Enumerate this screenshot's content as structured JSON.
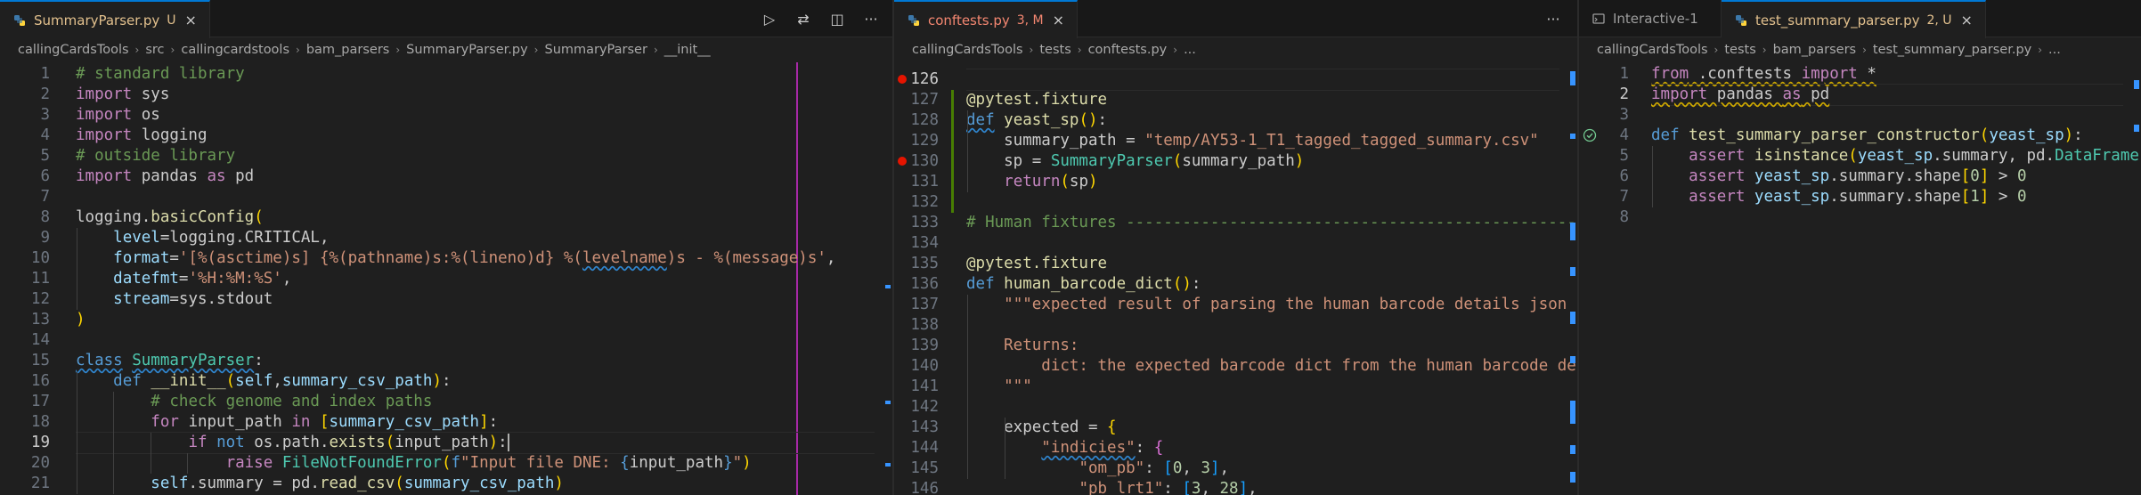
{
  "colors": {
    "keyword": "#569cd6",
    "control": "#c586c0",
    "function": "#dcdcaa",
    "class": "#4ec9b0",
    "string": "#ce9178",
    "number": "#b5cea8",
    "comment": "#6a9955",
    "variable": "#9cdcfe",
    "accent": "#0078d4",
    "ruler": "#a629a6",
    "error": "#f48771",
    "modified": "#e2c08d",
    "breakpoint": "#e51400"
  },
  "pane1": {
    "tab": {
      "name": "SummaryParser.py",
      "status": "U",
      "close": "×",
      "icon": "python-file-icon"
    },
    "actions": [
      {
        "name": "run-python-icon",
        "glyph": "▷"
      },
      {
        "name": "compare-changes-icon",
        "glyph": "⇄"
      },
      {
        "name": "split-editor-icon",
        "glyph": "◫"
      },
      {
        "name": "more-actions-icon",
        "glyph": "···"
      }
    ],
    "breadcrumb": [
      "callingCardsTools",
      "src",
      "callingcardstools",
      "bam_parsers",
      "SummaryParser.py",
      "SummaryParser",
      "__init__"
    ],
    "lines": [
      {
        "n": "1",
        "tokens": [
          {
            "c": "cm",
            "t": "# standard library"
          }
        ]
      },
      {
        "n": "2",
        "tokens": [
          {
            "c": "kw2",
            "t": "import"
          },
          {
            "c": "plain",
            "t": " sys"
          }
        ]
      },
      {
        "n": "3",
        "tokens": [
          {
            "c": "kw2",
            "t": "import"
          },
          {
            "c": "plain",
            "t": " os"
          }
        ]
      },
      {
        "n": "4",
        "tokens": [
          {
            "c": "kw2",
            "t": "import"
          },
          {
            "c": "plain",
            "t": " logging"
          }
        ]
      },
      {
        "n": "5",
        "tokens": [
          {
            "c": "cm",
            "t": "# outside library"
          }
        ]
      },
      {
        "n": "6",
        "tokens": [
          {
            "c": "kw2",
            "t": "import"
          },
          {
            "c": "plain",
            "t": " pandas "
          },
          {
            "c": "kw2",
            "t": "as"
          },
          {
            "c": "plain",
            "t": " pd"
          }
        ]
      },
      {
        "n": "7",
        "tokens": []
      },
      {
        "n": "8",
        "tokens": [
          {
            "c": "plain",
            "t": "logging."
          },
          {
            "c": "fn",
            "t": "basicConfig"
          },
          {
            "c": "par",
            "t": "("
          }
        ]
      },
      {
        "n": "9",
        "tokens": [
          {
            "c": "plain",
            "t": "    "
          },
          {
            "c": "var",
            "t": "level"
          },
          {
            "c": "plain",
            "t": "=logging.CRITICAL,"
          }
        ]
      },
      {
        "n": "10",
        "tokens": [
          {
            "c": "plain",
            "t": "    "
          },
          {
            "c": "var",
            "t": "format"
          },
          {
            "c": "plain",
            "t": "="
          },
          {
            "c": "str",
            "t": "'[%(asctime)s] {%(pathname)s:%(lineno)d} %("
          },
          {
            "c": "str sq",
            "t": "levelname"
          },
          {
            "c": "str",
            "t": ")s - %(message)s'"
          },
          {
            "c": "plain",
            "t": ","
          }
        ]
      },
      {
        "n": "11",
        "tokens": [
          {
            "c": "plain",
            "t": "    "
          },
          {
            "c": "var",
            "t": "datefmt"
          },
          {
            "c": "plain",
            "t": "="
          },
          {
            "c": "str",
            "t": "'%H:%M:%S'"
          },
          {
            "c": "plain",
            "t": ","
          }
        ]
      },
      {
        "n": "12",
        "tokens": [
          {
            "c": "plain",
            "t": "    "
          },
          {
            "c": "var",
            "t": "stream"
          },
          {
            "c": "plain",
            "t": "=sys.stdout"
          }
        ]
      },
      {
        "n": "13",
        "tokens": [
          {
            "c": "par",
            "t": ")"
          }
        ]
      },
      {
        "n": "14",
        "tokens": []
      },
      {
        "n": "15",
        "tokens": [
          {
            "c": "kw sq",
            "t": "class"
          },
          {
            "c": "plain",
            "t": " "
          },
          {
            "c": "cls sq",
            "t": "SummaryParser"
          },
          {
            "c": "plain",
            "t": ":"
          }
        ]
      },
      {
        "n": "16",
        "tokens": [
          {
            "c": "plain",
            "t": "    "
          },
          {
            "c": "kw",
            "t": "def"
          },
          {
            "c": "plain",
            "t": " "
          },
          {
            "c": "fn",
            "t": "__init__"
          },
          {
            "c": "par",
            "t": "("
          },
          {
            "c": "var",
            "t": "self"
          },
          {
            "c": "plain",
            "t": ","
          },
          {
            "c": "var",
            "t": "summary_csv_path"
          },
          {
            "c": "par",
            "t": ")"
          },
          {
            "c": "plain",
            "t": ":"
          }
        ]
      },
      {
        "n": "17",
        "tokens": [
          {
            "c": "plain",
            "t": "        "
          },
          {
            "c": "cm",
            "t": "# check genome and index paths"
          }
        ]
      },
      {
        "n": "18",
        "tokens": [
          {
            "c": "plain",
            "t": "        "
          },
          {
            "c": "kw2",
            "t": "for"
          },
          {
            "c": "plain",
            "t": " input_path "
          },
          {
            "c": "kw2",
            "t": "in"
          },
          {
            "c": "plain",
            "t": " "
          },
          {
            "c": "par",
            "t": "["
          },
          {
            "c": "var",
            "t": "summary_csv_path"
          },
          {
            "c": "par",
            "t": "]"
          },
          {
            "c": "plain",
            "t": ":"
          }
        ]
      },
      {
        "n": "19",
        "tokens": [
          {
            "c": "plain",
            "t": "            "
          },
          {
            "c": "kw2",
            "t": "if"
          },
          {
            "c": "plain",
            "t": " "
          },
          {
            "c": "kw",
            "t": "not"
          },
          {
            "c": "plain",
            "t": " os.path."
          },
          {
            "c": "fn",
            "t": "exists"
          },
          {
            "c": "par",
            "t": "("
          },
          {
            "c": "plain",
            "t": "input_path"
          },
          {
            "c": "par",
            "t": ")"
          },
          {
            "c": "plain",
            "t": ":"
          }
        ]
      },
      {
        "n": "20",
        "tokens": [
          {
            "c": "plain",
            "t": "                "
          },
          {
            "c": "kw2",
            "t": "raise"
          },
          {
            "c": "plain",
            "t": " "
          },
          {
            "c": "cls",
            "t": "FileNotFoundError"
          },
          {
            "c": "par",
            "t": "("
          },
          {
            "c": "kw",
            "t": "f"
          },
          {
            "c": "str",
            "t": "\"Input file DNE: "
          },
          {
            "c": "kw",
            "t": "{"
          },
          {
            "c": "plain",
            "t": "input_path"
          },
          {
            "c": "kw",
            "t": "}"
          },
          {
            "c": "str",
            "t": "\""
          },
          {
            "c": "par",
            "t": ")"
          }
        ]
      },
      {
        "n": "21",
        "tokens": [
          {
            "c": "plain",
            "t": "        "
          },
          {
            "c": "var",
            "t": "self"
          },
          {
            "c": "plain",
            "t": ".summary = pd."
          },
          {
            "c": "fn",
            "t": "read_csv"
          },
          {
            "c": "par",
            "t": "("
          },
          {
            "c": "var",
            "t": "summary_csv_path"
          },
          {
            "c": "par",
            "t": ")"
          }
        ]
      }
    ]
  },
  "pane2": {
    "tab": {
      "name": "conftests.py",
      "status": "3, M",
      "close": "×",
      "icon": "python-file-icon"
    },
    "actions": [
      {
        "name": "more-actions-icon",
        "glyph": "···"
      }
    ],
    "breadcrumb": [
      "callingCardsTools",
      "tests",
      "conftests.py",
      "..."
    ],
    "lines": [
      {
        "n": "126",
        "tokens": []
      },
      {
        "n": "127",
        "tokens": [
          {
            "c": "dec",
            "t": "@pytest.fixture"
          }
        ]
      },
      {
        "n": "128",
        "tokens": [
          {
            "c": "kw sq",
            "t": "def"
          },
          {
            "c": "plain",
            "t": " "
          },
          {
            "c": "fn",
            "t": "yeast_sp"
          },
          {
            "c": "par",
            "t": "()"
          },
          {
            "c": "plain",
            "t": ":"
          }
        ]
      },
      {
        "n": "129",
        "tokens": [
          {
            "c": "plain",
            "t": "    summary_path = "
          },
          {
            "c": "str",
            "t": "\"temp/AY53-1_T1_tagged_tagged_summary.csv\""
          }
        ]
      },
      {
        "n": "130",
        "tokens": [
          {
            "c": "plain",
            "t": "    sp = "
          },
          {
            "c": "cls",
            "t": "SummaryParser"
          },
          {
            "c": "par",
            "t": "("
          },
          {
            "c": "plain",
            "t": "summary_path"
          },
          {
            "c": "par",
            "t": ")"
          }
        ]
      },
      {
        "n": "131",
        "tokens": [
          {
            "c": "plain",
            "t": "    "
          },
          {
            "c": "kw2",
            "t": "return"
          },
          {
            "c": "par",
            "t": "("
          },
          {
            "c": "plain",
            "t": "sp"
          },
          {
            "c": "par",
            "t": ")"
          }
        ]
      },
      {
        "n": "132",
        "tokens": []
      },
      {
        "n": "133",
        "tokens": [
          {
            "c": "cm",
            "t": "# Human fixtures ------------------------------------------------------------------------"
          }
        ]
      },
      {
        "n": "134",
        "tokens": []
      },
      {
        "n": "135",
        "tokens": [
          {
            "c": "dec",
            "t": "@pytest.fixture"
          }
        ]
      },
      {
        "n": "136",
        "tokens": [
          {
            "c": "kw",
            "t": "def"
          },
          {
            "c": "plain",
            "t": " "
          },
          {
            "c": "fn",
            "t": "human_barcode_dict"
          },
          {
            "c": "par",
            "t": "()"
          },
          {
            "c": "plain",
            "t": ":"
          }
        ]
      },
      {
        "n": "137",
        "tokens": [
          {
            "c": "plain",
            "t": "    "
          },
          {
            "c": "str",
            "t": "\"\"\"expected result of parsing the human barcode details json"
          }
        ]
      },
      {
        "n": "138",
        "tokens": []
      },
      {
        "n": "139",
        "tokens": [
          {
            "c": "str",
            "t": "    Returns:"
          }
        ]
      },
      {
        "n": "140",
        "tokens": [
          {
            "c": "str",
            "t": "        dict: the expected barcode dict from the human barcode details"
          }
        ]
      },
      {
        "n": "141",
        "tokens": [
          {
            "c": "str",
            "t": "    \"\"\""
          }
        ]
      },
      {
        "n": "142",
        "tokens": []
      },
      {
        "n": "143",
        "tokens": [
          {
            "c": "plain",
            "t": "    expected = "
          },
          {
            "c": "par",
            "t": "{"
          }
        ]
      },
      {
        "n": "144",
        "tokens": [
          {
            "c": "plain",
            "t": "        "
          },
          {
            "c": "str sq",
            "t": "\"indicies\""
          },
          {
            "c": "plain",
            "t": ": "
          },
          {
            "c": "par2",
            "t": "{"
          }
        ]
      },
      {
        "n": "145",
        "tokens": [
          {
            "c": "plain",
            "t": "            "
          },
          {
            "c": "str",
            "t": "\"om_pb\""
          },
          {
            "c": "plain",
            "t": ": "
          },
          {
            "c": "par3",
            "t": "["
          },
          {
            "c": "num",
            "t": "0"
          },
          {
            "c": "plain",
            "t": ", "
          },
          {
            "c": "num",
            "t": "3"
          },
          {
            "c": "par3",
            "t": "]"
          },
          {
            "c": "plain",
            "t": ","
          }
        ]
      },
      {
        "n": "146",
        "tokens": [
          {
            "c": "plain",
            "t": "            "
          },
          {
            "c": "str",
            "t": "\"pb_lrt1\""
          },
          {
            "c": "plain",
            "t": ": "
          },
          {
            "c": "par3",
            "t": "["
          },
          {
            "c": "num",
            "t": "3"
          },
          {
            "c": "plain",
            "t": ", "
          },
          {
            "c": "num",
            "t": "28"
          },
          {
            "c": "par3",
            "t": "]"
          },
          {
            "c": "plain",
            "t": ","
          }
        ]
      }
    ]
  },
  "pane3": {
    "tabs": [
      {
        "name": "Interactive-1",
        "status": "",
        "icon": "interactive-window-icon"
      },
      {
        "name": "test_summary_parser.py",
        "status": "2, U",
        "close": "×",
        "icon": "python-file-icon"
      }
    ],
    "breadcrumb": [
      "callingCardsTools",
      "tests",
      "bam_parsers",
      "test_summary_parser.py",
      "..."
    ],
    "lines": [
      {
        "n": "1",
        "tokens": [
          {
            "c": "kw2 sqy",
            "t": "from"
          },
          {
            "c": "plain sqy",
            "t": " .conftests "
          },
          {
            "c": "kw2 sqy",
            "t": "import"
          },
          {
            "c": "plain sqy",
            "t": " *"
          }
        ]
      },
      {
        "n": "2",
        "tokens": [
          {
            "c": "kw2 sqy",
            "t": "import"
          },
          {
            "c": "plain sqy",
            "t": " pandas "
          },
          {
            "c": "kw2 sqy",
            "t": "as"
          },
          {
            "c": "plain sqy",
            "t": " pd"
          }
        ]
      },
      {
        "n": "3",
        "tokens": []
      },
      {
        "n": "4",
        "tokens": [
          {
            "c": "kw",
            "t": "def"
          },
          {
            "c": "plain",
            "t": " "
          },
          {
            "c": "fn",
            "t": "test_summary_parser_constructor"
          },
          {
            "c": "par",
            "t": "("
          },
          {
            "c": "var",
            "t": "yeast_sp"
          },
          {
            "c": "par",
            "t": ")"
          },
          {
            "c": "plain",
            "t": ":"
          }
        ]
      },
      {
        "n": "5",
        "tokens": [
          {
            "c": "plain",
            "t": "    "
          },
          {
            "c": "kw2",
            "t": "assert"
          },
          {
            "c": "plain",
            "t": " "
          },
          {
            "c": "fn",
            "t": "isinstance"
          },
          {
            "c": "par",
            "t": "("
          },
          {
            "c": "var",
            "t": "yeast_sp"
          },
          {
            "c": "plain",
            "t": ".summary, pd."
          },
          {
            "c": "cls",
            "t": "DataFrame"
          },
          {
            "c": "par",
            "t": ")"
          }
        ]
      },
      {
        "n": "6",
        "tokens": [
          {
            "c": "plain",
            "t": "    "
          },
          {
            "c": "kw2",
            "t": "assert"
          },
          {
            "c": "plain",
            "t": " "
          },
          {
            "c": "var",
            "t": "yeast_sp"
          },
          {
            "c": "plain",
            "t": ".summary.shape"
          },
          {
            "c": "par",
            "t": "["
          },
          {
            "c": "num",
            "t": "0"
          },
          {
            "c": "par",
            "t": "]"
          },
          {
            "c": "plain",
            "t": " > "
          },
          {
            "c": "num",
            "t": "0"
          }
        ]
      },
      {
        "n": "7",
        "tokens": [
          {
            "c": "plain",
            "t": "    "
          },
          {
            "c": "kw2",
            "t": "assert"
          },
          {
            "c": "plain",
            "t": " "
          },
          {
            "c": "var",
            "t": "yeast_sp"
          },
          {
            "c": "plain",
            "t": ".summary.shape"
          },
          {
            "c": "par",
            "t": "["
          },
          {
            "c": "num",
            "t": "1"
          },
          {
            "c": "par",
            "t": "]"
          },
          {
            "c": "plain",
            "t": " > "
          },
          {
            "c": "num",
            "t": "0"
          }
        ]
      },
      {
        "n": "8",
        "tokens": []
      }
    ]
  }
}
